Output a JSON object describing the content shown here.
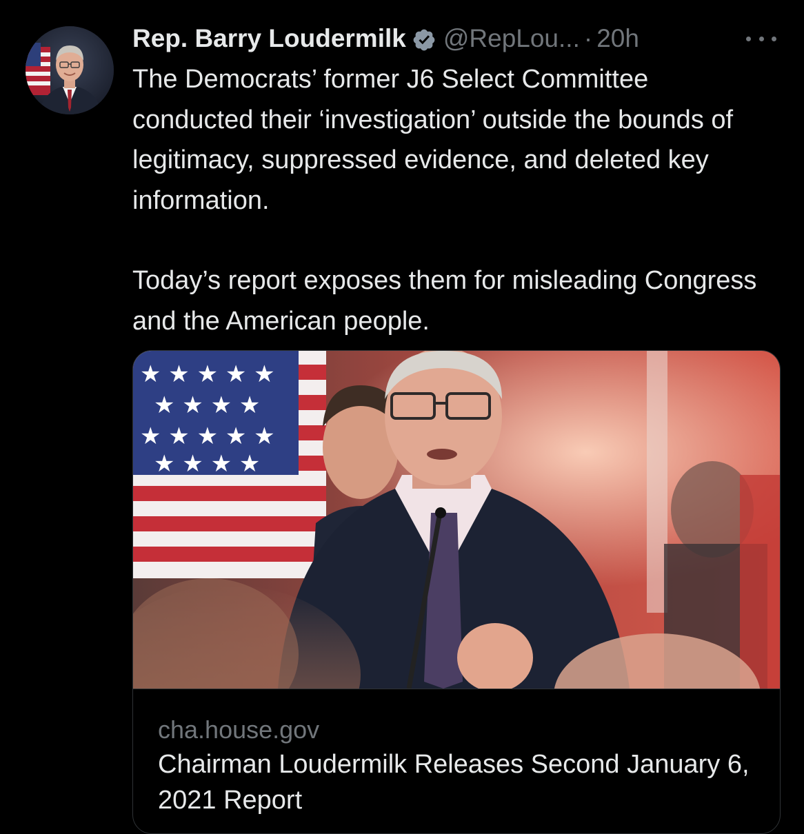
{
  "tweet": {
    "author": {
      "display_name": "Rep. Barry Loudermilk",
      "handle": "@RepLou...",
      "verified": true,
      "avatar_icon": "profile-photo"
    },
    "separator": "·",
    "timestamp": "20h",
    "more_icon": "ellipsis-icon",
    "paragraphs": [
      "The Democrats’ former J6 Select Committee conducted their ‘investigation’ outside the bounds of legitimacy, suppressed evidence, and deleted key information.",
      "Today’s report exposes them for misleading Congress and the American people."
    ],
    "link_card": {
      "image_icon": "press-conference-photo",
      "domain": "cha.house.gov",
      "title": "Chairman Loudermilk Releases Second January 6, 2021 Report"
    }
  },
  "colors": {
    "background": "#000000",
    "primary_text": "#e7e9ea",
    "secondary_text": "#71767b",
    "border": "#2f3336",
    "verified_badge": "#1d9bf0"
  }
}
